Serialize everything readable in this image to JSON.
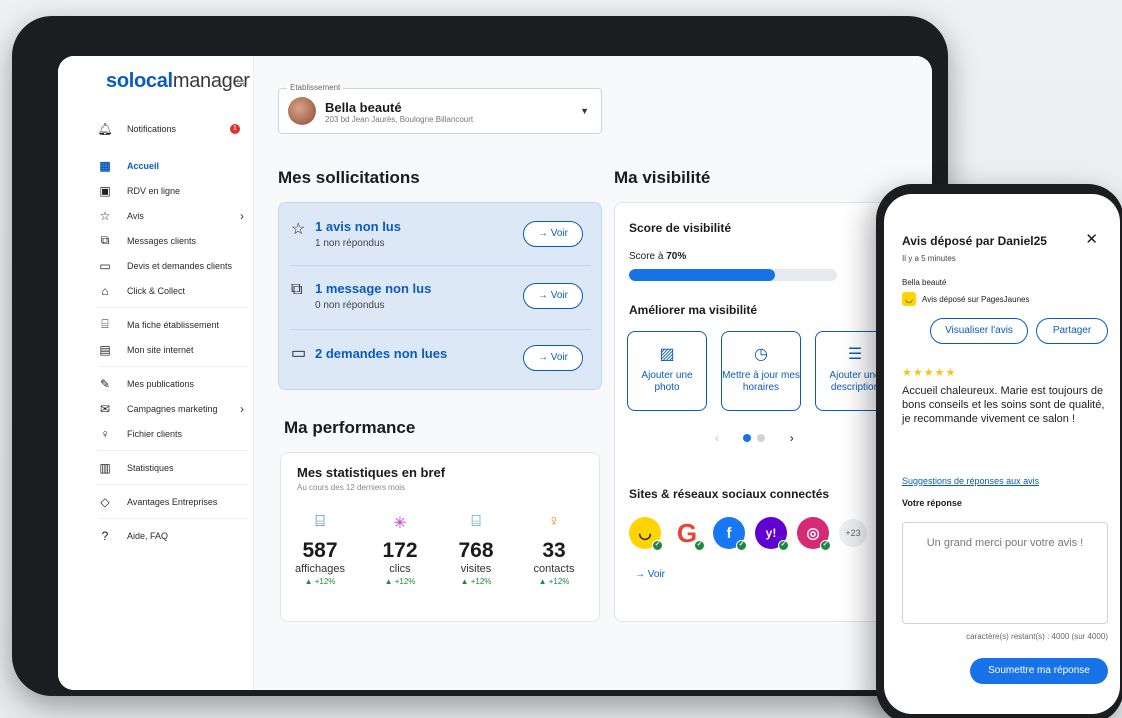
{
  "sidebar": {
    "logo_bold": "solocal",
    "logo_light": "manager",
    "collapse_icon": "≒",
    "notifications": {
      "label": "Notifications",
      "badge": "1"
    },
    "items": [
      {
        "label": "Accueil",
        "icon": "dashboard-icon"
      },
      {
        "label": "RDV en ligne",
        "icon": "calendar-icon"
      },
      {
        "label": "Avis",
        "icon": "star-icon"
      },
      {
        "label": "Messages clients",
        "icon": "chat-icon"
      },
      {
        "label": "Devis et demandes clients",
        "icon": "message-icon"
      },
      {
        "label": "Click & Collect",
        "icon": "basket-icon"
      },
      {
        "label": "Ma fiche établissement",
        "icon": "store-icon"
      },
      {
        "label": "Mon site internet",
        "icon": "browser-icon"
      },
      {
        "label": "Mes publications",
        "icon": "edit-icon"
      },
      {
        "label": "Campagnes marketing",
        "icon": "mail-icon"
      },
      {
        "label": "Fichier clients",
        "icon": "users-icon"
      },
      {
        "label": "Statistiques",
        "icon": "chart-icon"
      },
      {
        "label": "Avantages Entreprises",
        "icon": "tag-icon"
      },
      {
        "label": "Aide, FAQ",
        "icon": "help-icon"
      }
    ]
  },
  "etablissement": {
    "label": "Etablissement",
    "name": "Bella beauté",
    "address": "203 bd Jean Jaurès, Boulogne Billancourt"
  },
  "sollicitations": {
    "title": "Mes sollicitations",
    "rows": [
      {
        "title": "1 avis non lus",
        "subtitle": "1 non répondus",
        "button": "→ Voir"
      },
      {
        "title": "1 message non lus",
        "subtitle": "0 non répondus",
        "button": "→ Voir"
      },
      {
        "title": "2 demandes non lues",
        "subtitle": "",
        "button": "→ Voir"
      }
    ]
  },
  "performance": {
    "title": "Ma performance",
    "card_title": "Mes statistiques en bref",
    "card_subtitle": "Au cours des 12 derniers mois",
    "stats": [
      {
        "value": "587",
        "label": "affichages",
        "delta": "▲ +12%",
        "color": "#0b5bbd"
      },
      {
        "value": "172",
        "label": "clics",
        "delta": "▲ +12%",
        "color": "#c13ad8"
      },
      {
        "value": "768",
        "label": "visites",
        "delta": "▲ +12%",
        "color": "#1a8ab0"
      },
      {
        "value": "33",
        "label": "contacts",
        "delta": "▲ +12%",
        "color": "#f08a24"
      }
    ]
  },
  "visibilite": {
    "title": "Ma visibilité",
    "score_title": "Score de visibilité",
    "score_prefix": "Score à ",
    "score_value": "70%",
    "score_fraction": 0.7,
    "improve_title": "Améliorer ma visibilité",
    "cards": [
      {
        "label": "Ajouter une photo",
        "icon": "image-add-icon"
      },
      {
        "label": "Mettre à jour mes horaires",
        "icon": "clock-icon"
      },
      {
        "label": "Ajouter une description",
        "icon": "text-add-icon"
      }
    ],
    "networks_title": "Sites & réseaux sociaux connectés",
    "networks": [
      {
        "name": "PagesJaunes",
        "color": "#ffd400"
      },
      {
        "name": "Google",
        "color": "#ea4335"
      },
      {
        "name": "Facebook",
        "color": "#1877f2"
      },
      {
        "name": "Yahoo",
        "color": "#6001d2"
      },
      {
        "name": "Instagram",
        "color": "#d62976"
      }
    ],
    "more": "+23",
    "voir": "→ Voir"
  },
  "review": {
    "title": "Avis déposé par Daniel25",
    "time": "Il y a 5 minutes",
    "business": "Bella beauté",
    "source": "Avis déposé sur PagesJaunes",
    "btn_view": "Visualiser l'avis",
    "btn_share": "Partager",
    "stars": "★★★★★",
    "text": "Accueil chaleureux. Marie est toujours de bons conseils et les soins sont de qualité, je recommande vivement ce salon !",
    "suggestions": "Suggestions de réponses aux avis",
    "response_label": "Votre réponse",
    "response_value": "Un grand merci pour votre avis !",
    "counter": "caractère(s) restant(s) : 4000 (sur 4000)",
    "submit": "Soumettre ma réponse"
  }
}
